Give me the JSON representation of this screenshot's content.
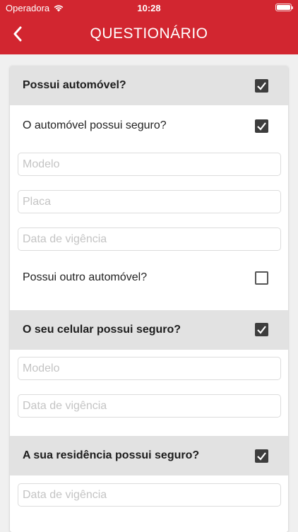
{
  "status_bar": {
    "carrier": "Operadora",
    "time": "10:28"
  },
  "header": {
    "title": "QUESTIONÁRIO",
    "back_icon": "chevron-left-icon"
  },
  "colors": {
    "header_bg": "#d22630",
    "section_bg": "#e2e2e2",
    "checkbox": "#3d3d3d"
  },
  "sections": {
    "car": {
      "question": "Possui automóvel?",
      "checked": true,
      "insured_question": "O automóvel possui seguro?",
      "insured_checked": true,
      "model_placeholder": "Modelo",
      "plate_placeholder": "Placa",
      "validity_placeholder": "Data de vigência",
      "other_car_question": "Possui outro automóvel?",
      "other_car_checked": false
    },
    "phone": {
      "question": "O seu celular possui seguro?",
      "checked": true,
      "model_placeholder": "Modelo",
      "validity_placeholder": "Data de vigência"
    },
    "home": {
      "question": "A sua residência possui seguro?",
      "checked": true,
      "validity_placeholder": "Data de vigência"
    }
  }
}
